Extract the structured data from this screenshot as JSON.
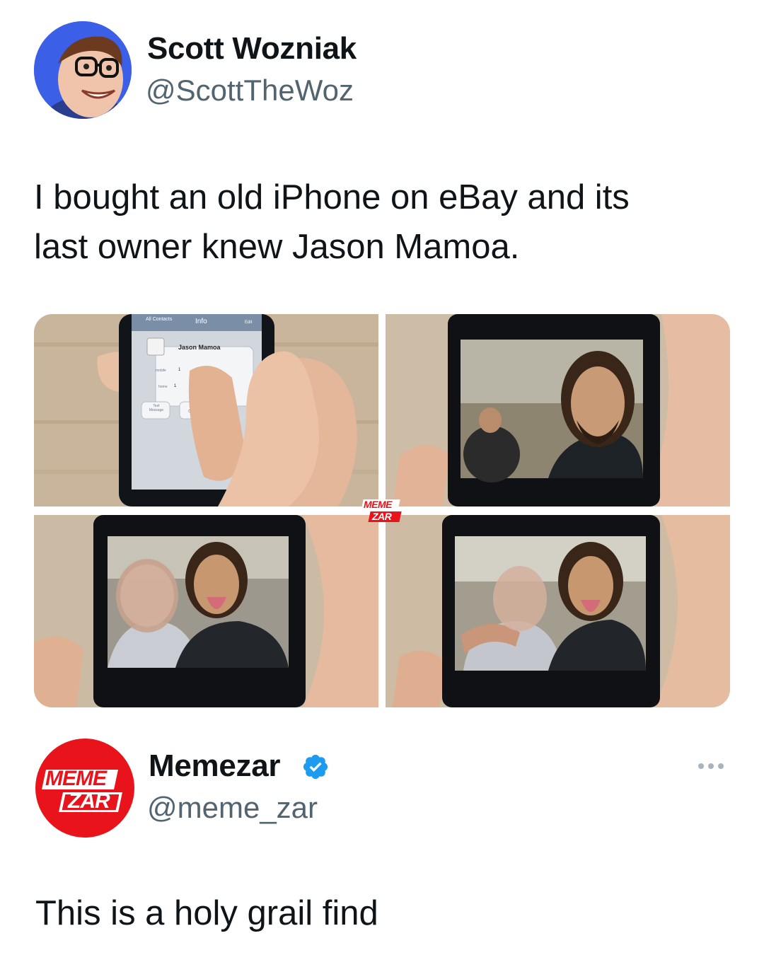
{
  "tweet1": {
    "author_name": "Scott Wozniak",
    "handle": "@ScottTheWoz",
    "text_line1": "I bought an old iPhone on eBay and its",
    "text_line2": "last owner knew Jason Mamoa.",
    "photos": {
      "p1": {
        "nav_back": "All Contacts",
        "nav_title": "Info",
        "nav_edit": "Edit",
        "contact_name": "Jason Mamoa",
        "row1_label": "mobile",
        "row1_value": "1",
        "row2_label": "home",
        "row2_value": "1",
        "text_btn_line1": "Text",
        "text_btn_line2": "Message",
        "call_btn": "C"
      }
    }
  },
  "watermark": {
    "line1": "MEME",
    "line2": "ZAR"
  },
  "tweet2": {
    "author_name": "Memezar",
    "verified": true,
    "handle": "@meme_zar",
    "avatar_line1": "MEME",
    "avatar_line2": "ZAR",
    "text": "This is a holy grail find",
    "more_icon": "more-horizontal-icon"
  },
  "colors": {
    "verified_blue": "#1d9bf0",
    "memezar_red": "#e8131b",
    "avatar_blue": "#3b5fe6",
    "handle_gray": "#536471"
  }
}
